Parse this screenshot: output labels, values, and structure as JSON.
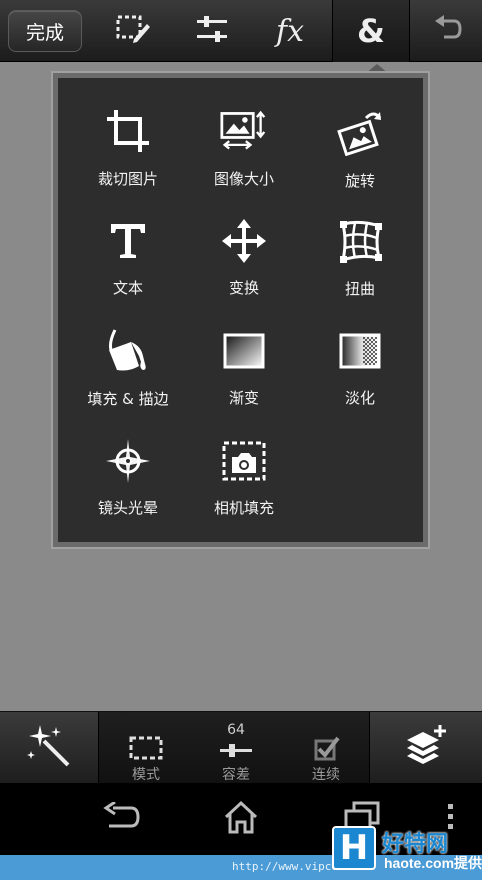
{
  "toolbar": {
    "done_label": "完成",
    "fx_label": "fx",
    "amp_label": "&",
    "icons": [
      "selection-edit-icon",
      "adjust-sliders-icon",
      "fx-icon",
      "ampersand-icon",
      "undo-icon"
    ]
  },
  "menu": {
    "items": [
      {
        "label": "裁切图片",
        "icon": "crop-icon"
      },
      {
        "label": "图像大小",
        "icon": "image-size-icon"
      },
      {
        "label": "旋转",
        "icon": "rotate-icon"
      },
      {
        "label": "文本",
        "icon": "text-icon"
      },
      {
        "label": "变换",
        "icon": "transform-move-icon"
      },
      {
        "label": "扭曲",
        "icon": "warp-icon"
      },
      {
        "label": "填充 & 描边",
        "icon": "paint-bucket-icon"
      },
      {
        "label": "渐变",
        "icon": "gradient-icon"
      },
      {
        "label": "淡化",
        "icon": "fade-icon"
      },
      {
        "label": "镜头光晕",
        "icon": "lens-flare-icon"
      },
      {
        "label": "相机填充",
        "icon": "camera-fill-icon"
      }
    ]
  },
  "bottombar": {
    "mode": {
      "label": "模式",
      "icon": "marquee-icon"
    },
    "tolerance": {
      "label": "容差",
      "value": "64",
      "icon": "slider-icon"
    },
    "contiguous": {
      "label": "连续",
      "icon": "checkbox-icon",
      "checked": true
    },
    "left_icon": "magic-wand-icon",
    "right_icon": "layers-add-icon"
  },
  "navbar": {
    "icons": [
      "back-icon",
      "home-icon",
      "recent-apps-icon",
      "overflow-menu-icon"
    ]
  },
  "watermark": {
    "url": "http://www.vipcom",
    "logo_letter": "H",
    "brand": "好特网",
    "domain": "haote.com",
    "credit": "提供"
  }
}
